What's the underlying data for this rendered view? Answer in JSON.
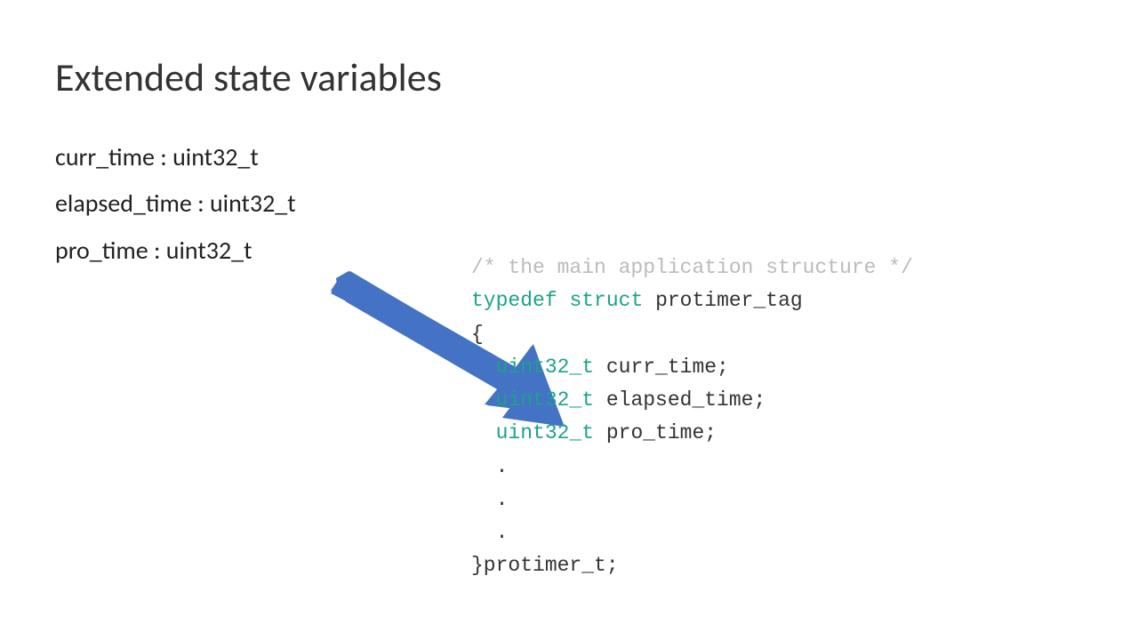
{
  "title": "Extended state variables",
  "variables": [
    {
      "name": "curr_time",
      "type": "uint32_t"
    },
    {
      "name": "elapsed_time ",
      "type": "uint32_t"
    },
    {
      "name": "pro_time",
      "type": "uint32_t"
    }
  ],
  "code": {
    "comment": "/* the main application structure */",
    "typedef_kw": "typedef",
    "struct_kw": "struct",
    "struct_name": " protimer_tag",
    "open_brace": "{",
    "members": [
      {
        "type": "uint32_t",
        "name": " curr_time;"
      },
      {
        "type": "uint32_t",
        "name": " elapsed_time;"
      },
      {
        "type": "uint32_t",
        "name": " pro_time;"
      }
    ],
    "dots": [
      ".",
      ".",
      "."
    ],
    "close_line": "}protimer_t;"
  },
  "colors": {
    "arrow": "#4472C4",
    "keyword": "#1ca389",
    "comment": "#bbbbbb"
  }
}
